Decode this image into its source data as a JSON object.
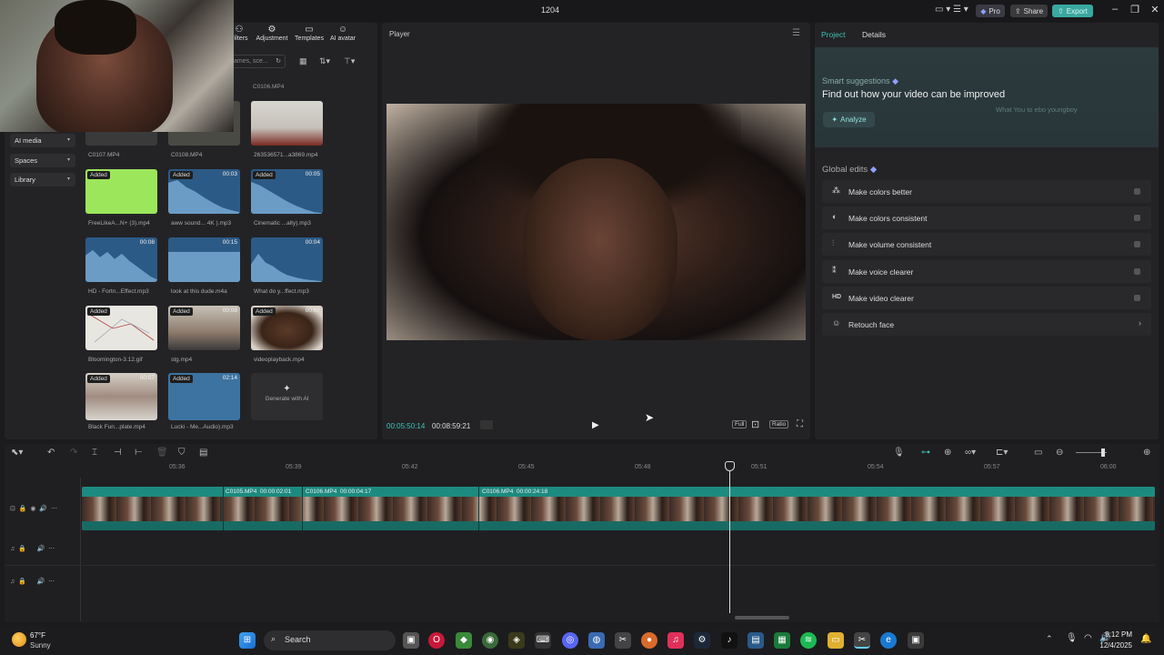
{
  "window": {
    "title": "1204",
    "pro": "Pro",
    "share": "Share",
    "export": "Export"
  },
  "toolbar_tabs": [
    {
      "label": "Filters",
      "icon": "filters-icon",
      "glyph": "⚇"
    },
    {
      "label": "Adjustment",
      "icon": "adjustment-icon",
      "glyph": "⚙"
    },
    {
      "label": "Templates",
      "icon": "templates-icon",
      "glyph": "▭"
    },
    {
      "label": "AI avatar",
      "icon": "ai-avatar-icon",
      "glyph": "☺"
    }
  ],
  "search": {
    "placeholder": "ames, sce..."
  },
  "nav": [
    "AI media",
    "Spaces",
    "Library"
  ],
  "media": {
    "row0": [
      "C0107.MP4",
      "C0108.MP4",
      "263536571...a3869.mp4"
    ],
    "top_label": "C0106.MP4",
    "items": [
      {
        "name": "FreeLikeA...N+ (3).mp4",
        "badge": "Added",
        "dur": ""
      },
      {
        "name": "aww sound... 4K ).mp3",
        "badge": "Added",
        "dur": "00:03"
      },
      {
        "name": "Cinematic ...alty).mp3",
        "badge": "Added",
        "dur": "00:05"
      },
      {
        "name": "HD - Fortn...Effect.mp3",
        "badge": "",
        "dur": "00:08"
      },
      {
        "name": "look at this dude.m4a",
        "badge": "",
        "dur": "00:15"
      },
      {
        "name": "What do y...ffect.mp3",
        "badge": "",
        "dur": "00:04"
      },
      {
        "name": "Bloomington-3.12.gif",
        "badge": "Added",
        "dur": ""
      },
      {
        "name": "stg.mp4",
        "badge": "Added",
        "dur": "00:08"
      },
      {
        "name": "videoplayback.mp4",
        "badge": "Added",
        "dur": "00:07"
      },
      {
        "name": "Black Fun...plate.mp4",
        "badge": "Added",
        "dur": "00:07"
      },
      {
        "name": "Lucki - Me...Audio).mp3",
        "badge": "Added",
        "dur": "02:14"
      }
    ],
    "generate": "Generate with AI"
  },
  "player": {
    "label": "Player",
    "current": "00:05:50:14",
    "total": "00:08:59:21",
    "full": "Full",
    "ratio": "Ratio"
  },
  "right": {
    "tab_project": "Project",
    "tab_details": "Details",
    "smart_title": "Smart suggestions",
    "smart_desc": "Find out how your video can be improved",
    "analyze": "Analyze",
    "hint": "What You to ebo youngboy",
    "global_title": "Global edits",
    "edits": [
      {
        "label": "Make colors better",
        "icon": "magic-wand-icon",
        "glyph": "⁂"
      },
      {
        "label": "Make colors consistent",
        "icon": "palette-icon",
        "glyph": "◐"
      },
      {
        "label": "Make volume consistent",
        "icon": "volume-bars-icon",
        "glyph": "⫶"
      },
      {
        "label": "Make voice clearer",
        "icon": "voice-icon",
        "glyph": "⁑"
      },
      {
        "label": "Make video clearer",
        "icon": "hd-icon",
        "glyph": "HD"
      },
      {
        "label": "Retouch face",
        "icon": "face-icon",
        "glyph": "☺"
      }
    ]
  },
  "timeline": {
    "ruler": [
      "05:36",
      "05:39",
      "05:42",
      "05:45",
      "05:48",
      "05:51",
      "05:54",
      "05:57",
      "06:00"
    ],
    "clips": [
      {
        "name": "C0105.MP4",
        "dur": "00:00:02:01"
      },
      {
        "name": "C0106.MP4",
        "dur": "00:00:04:17"
      },
      {
        "name": "C0106.MP4",
        "dur": "00:00:24:18"
      }
    ]
  },
  "taskbar": {
    "temp": "67°F",
    "condition": "Sunny",
    "search": "Search",
    "time": "8:12 PM",
    "date": "12/4/2025"
  }
}
